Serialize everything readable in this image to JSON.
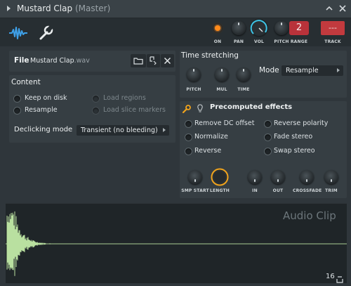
{
  "window": {
    "title": "Mustard Clap",
    "subtitle": "(Master)"
  },
  "toolbar": {
    "on_label": "ON",
    "pan_label": "PAN",
    "vol_label": "VOL",
    "pitch_label": "PITCH",
    "range_label": "RANGE",
    "range_value": "2",
    "track_label": "TRACK",
    "track_value": "---",
    "colors": {
      "accent": "#3ea0e8",
      "led": "#ff8a1a",
      "track": "#c23a3e",
      "range": "#b8323a"
    }
  },
  "file": {
    "label": "File",
    "name": "Mustard Clap",
    "ext": ".wav"
  },
  "content": {
    "title": "Content",
    "keep_on_disk": "Keep on disk",
    "resample": "Resample",
    "load_regions": "Load regions",
    "load_slice_markers": "Load slice markers",
    "declicking_label": "Declicking mode",
    "declicking_value": "Transient (no bleeding)"
  },
  "time_stretching": {
    "title": "Time stretching",
    "pitch": "PITCH",
    "mul": "MUL",
    "time": "TIME",
    "mode_label": "Mode",
    "mode_value": "Resample"
  },
  "precomputed": {
    "title": "Precomputed effects",
    "remove_dc": "Remove DC offset",
    "normalize": "Normalize",
    "reverse": "Reverse",
    "reverse_polarity": "Reverse polarity",
    "fade_stereo": "Fade stereo",
    "swap_stereo": "Swap stereo",
    "knobs": {
      "smp_start": "SMP START",
      "length": "LENGTH",
      "in": "IN",
      "out": "OUT",
      "crossfade": "CROSSFADE",
      "trim": "TRIM"
    }
  },
  "waveform": {
    "watermark": "Audio Clip",
    "page": "16",
    "color": "#b9e0a0"
  }
}
